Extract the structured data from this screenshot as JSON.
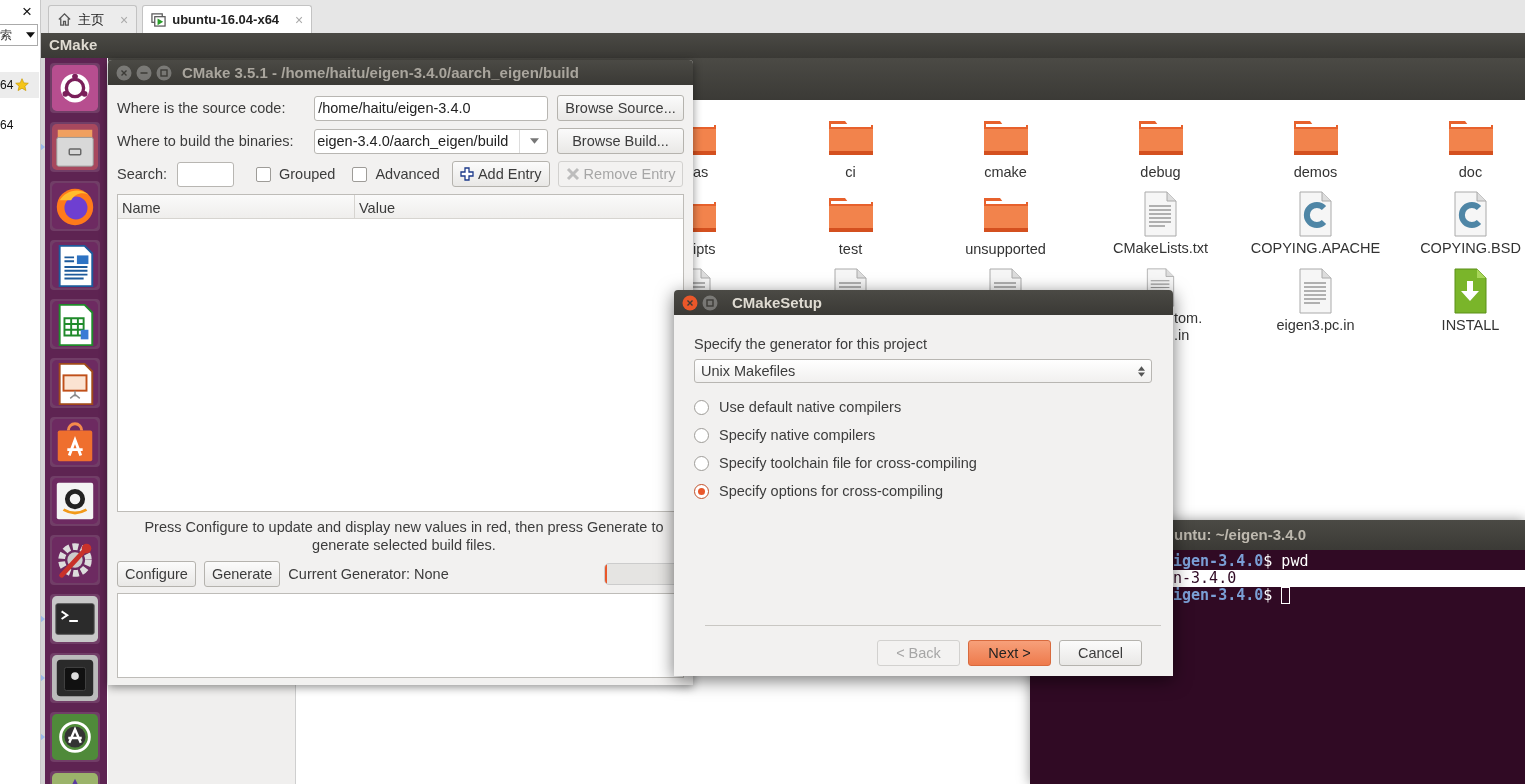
{
  "host": {
    "close": "×",
    "search_text": "索",
    "items": [
      {
        "text": "64",
        "starred": true,
        "selected": true
      },
      {
        "text": "64",
        "starred": false,
        "selected": false
      }
    ]
  },
  "tabs": [
    {
      "kind": "home",
      "label": "主页",
      "close": "×",
      "selected": false
    },
    {
      "kind": "vm",
      "label": "ubuntu-16.04-x64",
      "close": "×",
      "selected": true
    }
  ],
  "top_bar": {
    "title": "CMake"
  },
  "launcher": [
    {
      "kind": "ubuntu",
      "running": false
    },
    {
      "kind": "files",
      "running": true
    },
    {
      "kind": "firefox",
      "running": false
    },
    {
      "kind": "writer",
      "running": false
    },
    {
      "kind": "calc",
      "running": false
    },
    {
      "kind": "impress",
      "running": false
    },
    {
      "kind": "software",
      "running": false
    },
    {
      "kind": "amazon",
      "running": false
    },
    {
      "kind": "settings",
      "running": false
    },
    {
      "kind": "terminal",
      "running": true
    },
    {
      "kind": "disk",
      "running": true
    },
    {
      "kind": "updater",
      "running": true
    },
    {
      "kind": "app",
      "running": false
    }
  ],
  "files": {
    "rows": [
      [
        {
          "kind": "folder",
          "label": "as"
        },
        {
          "kind": "folder",
          "label": "ci"
        },
        {
          "kind": "folder",
          "label": "cmake"
        },
        {
          "kind": "folder",
          "label": "debug"
        },
        {
          "kind": "folder",
          "label": "demos"
        },
        {
          "kind": "folder",
          "label": "doc"
        }
      ],
      [
        {
          "kind": "folder",
          "label": "ipts"
        },
        {
          "kind": "folder",
          "label": "test"
        },
        {
          "kind": "folder",
          "label": "unsupported"
        },
        {
          "kind": "text",
          "label": "CMakeLists.txt"
        },
        {
          "kind": "code",
          "label": "COPYING.APACHE"
        },
        {
          "kind": "code",
          "label": "COPYING.BSD"
        }
      ],
      [
        {
          "kind": "text"
        },
        {
          "kind": "text"
        },
        {
          "kind": "text"
        },
        {
          "kind": "text",
          "label": "tom.\n.in"
        },
        {
          "kind": "text",
          "label": "eigen3.pc.in"
        },
        {
          "kind": "install",
          "label": "INSTALL"
        }
      ]
    ]
  },
  "terminal": {
    "title": "untu: ~/eigen-3.4.0",
    "lines": [
      {
        "kind": "prompt",
        "path": "igen-3.4.0",
        "sign": "$",
        "command": "pwd",
        "cursor": false,
        "highlighted": false
      },
      {
        "kind": "output",
        "text": "n-3.4.0",
        "highlighted": true
      },
      {
        "kind": "prompt",
        "path": "igen-3.4.0",
        "sign": "$",
        "cursor": true,
        "highlighted": false
      }
    ]
  },
  "cmake": {
    "title": "CMake 3.5.1 - /home/haitu/eigen-3.4.0/aarch_eigen/build",
    "source_label": "Where is the source code:",
    "source_value": "/home/haitu/eigen-3.4.0",
    "browse_source": "Browse Source...",
    "build_label": "Where to build the binaries:",
    "build_value": "eigen-3.4.0/aarch_eigen/build",
    "browse_build": "Browse Build...",
    "search_label": "Search:",
    "grouped": {
      "label": "Grouped",
      "checked": false
    },
    "advanced": {
      "label": "Advanced",
      "checked": false
    },
    "add_entry": {
      "label": "Add Entry",
      "disabled": false
    },
    "remove_entry": {
      "label": "Remove Entry",
      "disabled": true
    },
    "columns": [
      "Name",
      "Value"
    ],
    "hint": "Press Configure to update and display new values in red, then press Generate to generate selected build files.",
    "configure": "Configure",
    "generate": "Generate",
    "generator": "Current Generator: None",
    "progress": {
      "level": 0.02
    }
  },
  "setup": {
    "title": "CMakeSetup",
    "prompt": "Specify the generator for this project",
    "generator": "Unix Makefiles",
    "options": [
      {
        "label": "Use default native compilers",
        "selected": false
      },
      {
        "label": "Specify native compilers",
        "selected": false
      },
      {
        "label": "Specify toolchain file for cross-compiling",
        "selected": false
      },
      {
        "label": "Specify options for cross-compiling",
        "selected": true
      }
    ],
    "buttons": [
      {
        "kind": "back",
        "label": "< Back",
        "disabled": true
      },
      {
        "kind": "next",
        "label": "Next >",
        "disabled": false
      },
      {
        "kind": "cancel",
        "label": "Cancel",
        "disabled": false
      }
    ]
  }
}
